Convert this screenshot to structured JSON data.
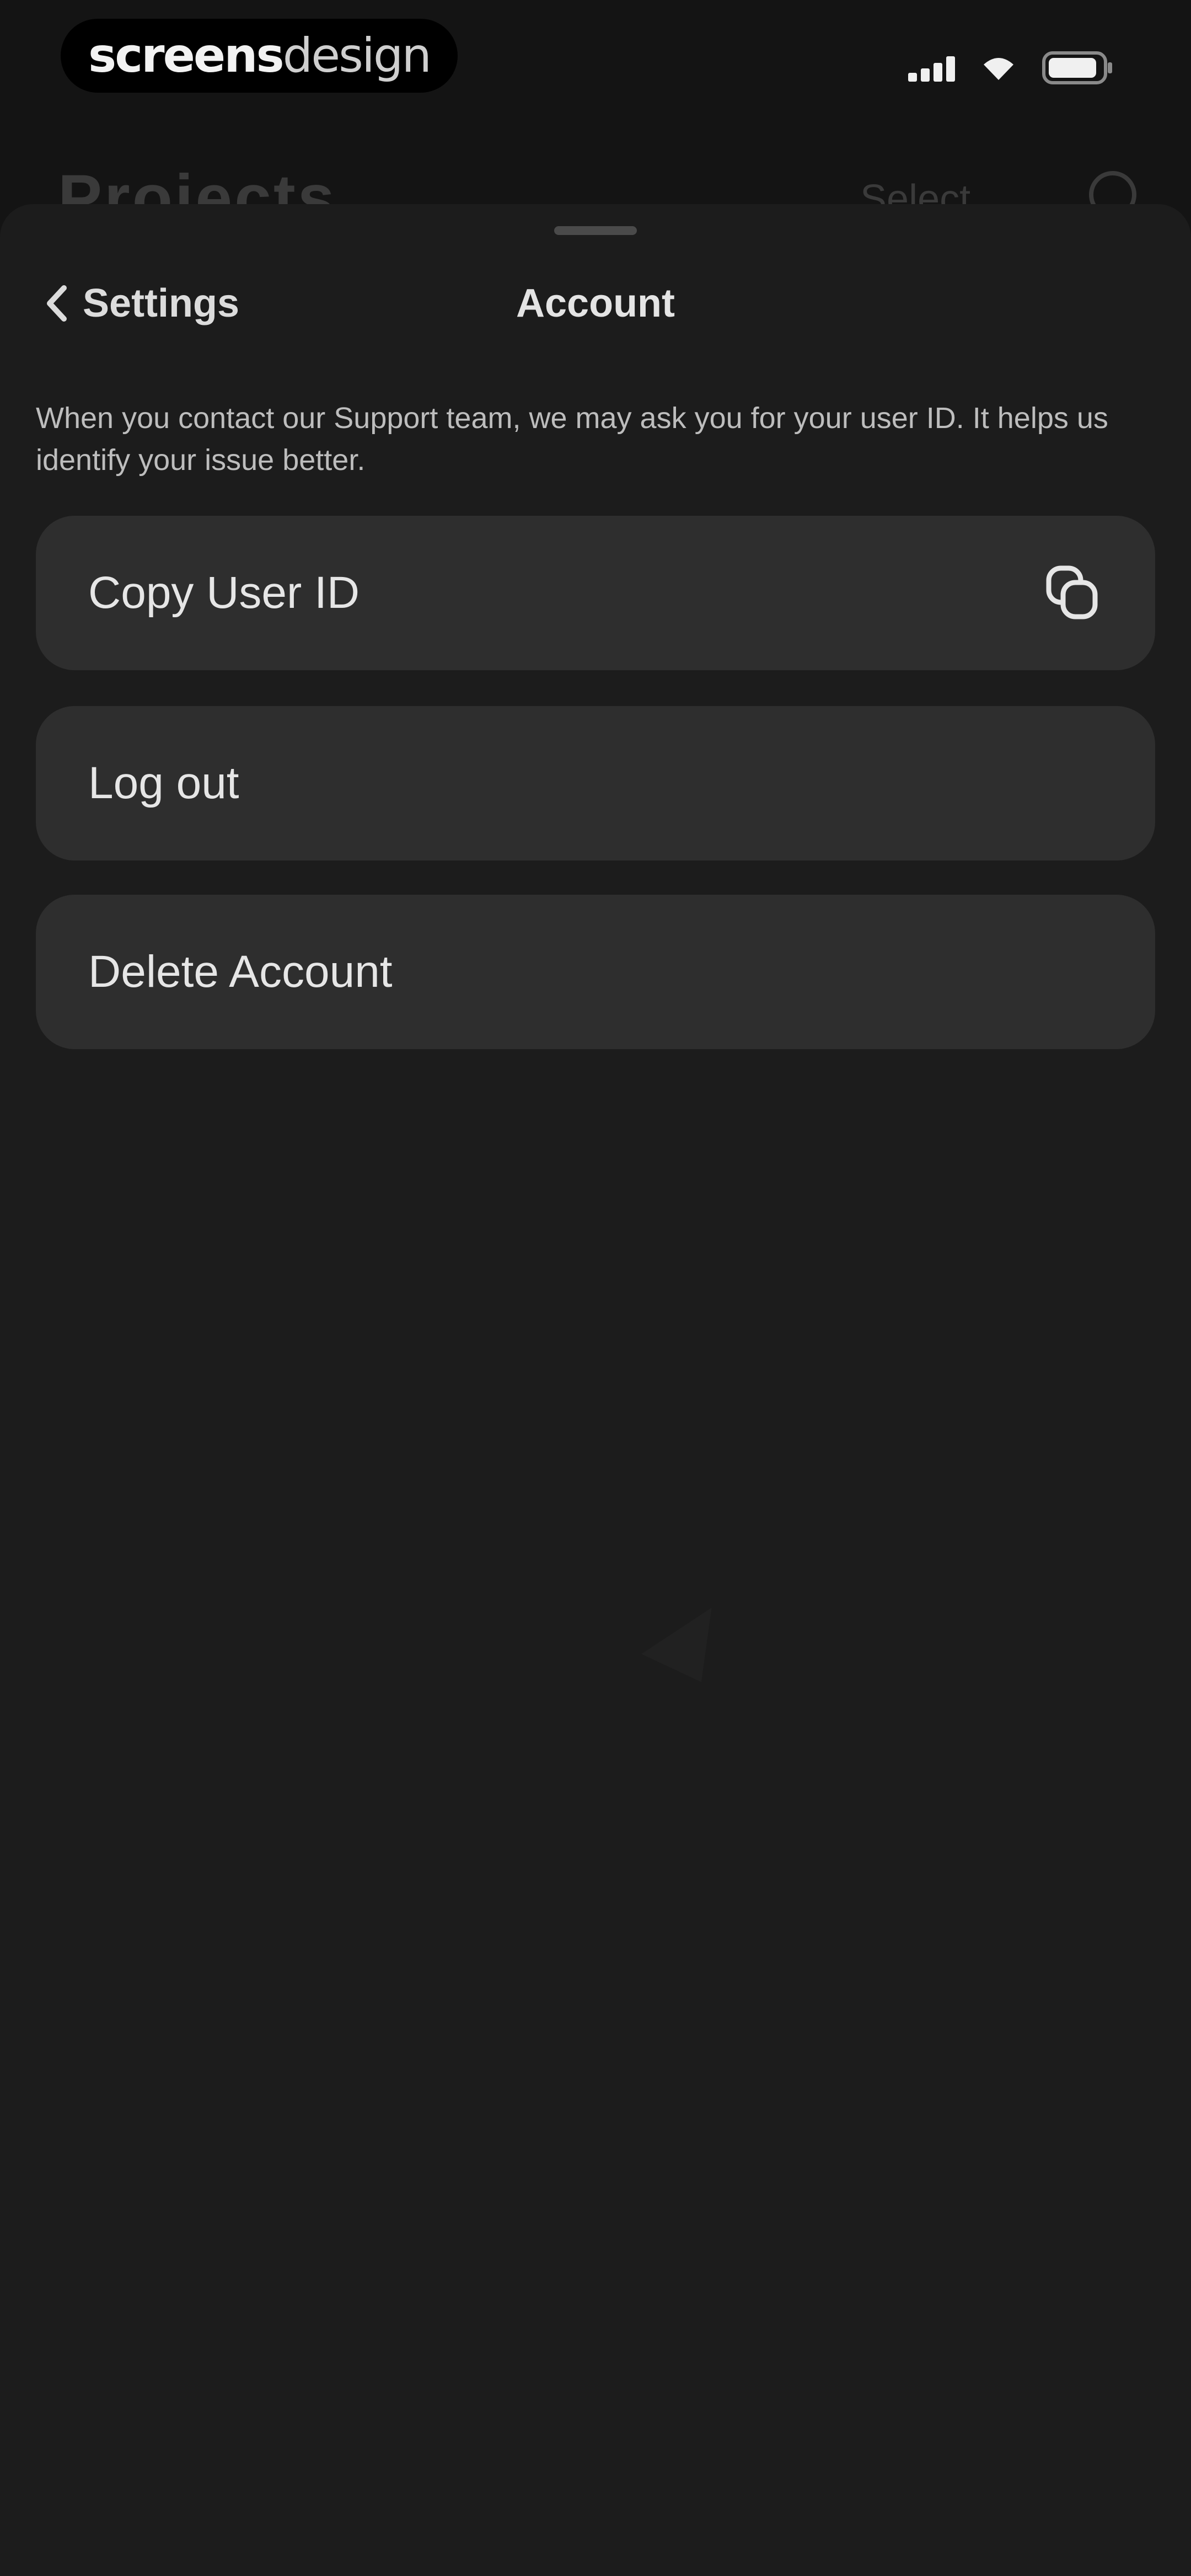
{
  "status_bar": {
    "watermark_bold": "screens",
    "watermark_light": "design",
    "icons": [
      "signal-icon",
      "wifi-icon",
      "battery-icon"
    ]
  },
  "background_page": {
    "title": "Projects",
    "select_label": "Select"
  },
  "sheet": {
    "back_label": "Settings",
    "title": "Account",
    "description": "When you contact our Support team, we may ask you for your user ID. It helps us identify your issue better.",
    "rows": [
      {
        "label": "Copy User ID",
        "icon": "copy-icon"
      },
      {
        "label": "Log out"
      },
      {
        "label": "Delete Account"
      }
    ]
  },
  "colors": {
    "background": "#141414",
    "sheet": "#1c1c1c",
    "row": "#2e2e2e",
    "text": "#e6e6e6"
  }
}
